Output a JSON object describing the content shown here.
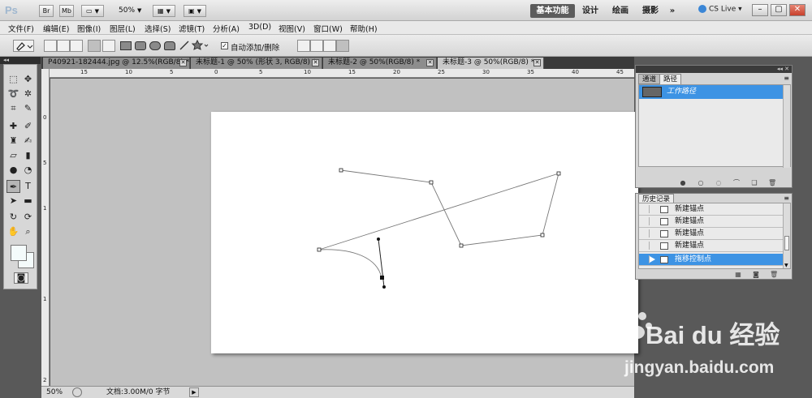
{
  "app": {
    "logo": "Ps",
    "titlebar": {
      "box_labels": [
        "Br",
        "Mb"
      ],
      "zoom": "50%",
      "workspaces": [
        "基本功能",
        "设计",
        "绘画",
        "摄影"
      ],
      "more": "»",
      "cs_live": "CS Live",
      "win_controls": [
        "–",
        "▢",
        "✕"
      ]
    }
  },
  "menu": [
    "文件(F)",
    "编辑(E)",
    "图像(I)",
    "图层(L)",
    "选择(S)",
    "滤镜(T)",
    "分析(A)",
    "3D(D)",
    "视图(V)",
    "窗口(W)",
    "帮助(H)"
  ],
  "options": {
    "auto_add_delete": "自动添加/删除",
    "checkbox_mark": "✓"
  },
  "tabs": [
    {
      "label": "P40921-182444.jpg @ 12.5%(RGB/8) *"
    },
    {
      "label": "未标题-1 @ 50% (形状 3, RGB/8) *"
    },
    {
      "label": "未标题-2 @ 50%(RGB/8) *"
    },
    {
      "label": "未标题-3 @ 50%(RGB/8) *"
    }
  ],
  "rulers": {
    "h_labels": [
      "15",
      "10",
      "5",
      "0",
      "5",
      "10",
      "15",
      "20",
      "25",
      "30",
      "35",
      "40",
      "45"
    ],
    "v_labels": [
      "0",
      "5",
      "1",
      "1",
      "2"
    ]
  },
  "status": {
    "zoom": "50%",
    "doc_info": "文档:3.00M/0 字节",
    "arrow": "▶"
  },
  "paths_panel": {
    "tabs": [
      "通道",
      "路径"
    ],
    "work_path": "工作路径",
    "menu": "≡",
    "collapse": "◂◂ ✕"
  },
  "history_panel": {
    "title": "历史记录",
    "items": [
      "新建锚点",
      "新建锚点",
      "新建锚点",
      "新建锚点",
      "拖移控制点"
    ],
    "active_index": 4,
    "menu": "≡",
    "scroll_arrow": "▼"
  },
  "watermark": {
    "brand": "Bai du 经验",
    "url": "jingyan.baidu.com"
  },
  "colors": {
    "selection_blue": "#3d93e4",
    "dark_bg": "#595959",
    "canvas_bg": "#c1c1c1"
  },
  "icons": [
    "pen-tool-icon",
    "marquee-icon",
    "move-icon",
    "lasso-icon",
    "magic-wand-icon",
    "crop-icon",
    "eyedropper-icon",
    "brush-icon",
    "stamp-icon",
    "eraser-icon",
    "gradient-icon",
    "blur-icon",
    "dodge-icon",
    "type-icon",
    "path-select-icon",
    "shape-icon",
    "hand-icon",
    "zoom-icon",
    "3d-rotate-icon",
    "quick-mask-icon"
  ]
}
